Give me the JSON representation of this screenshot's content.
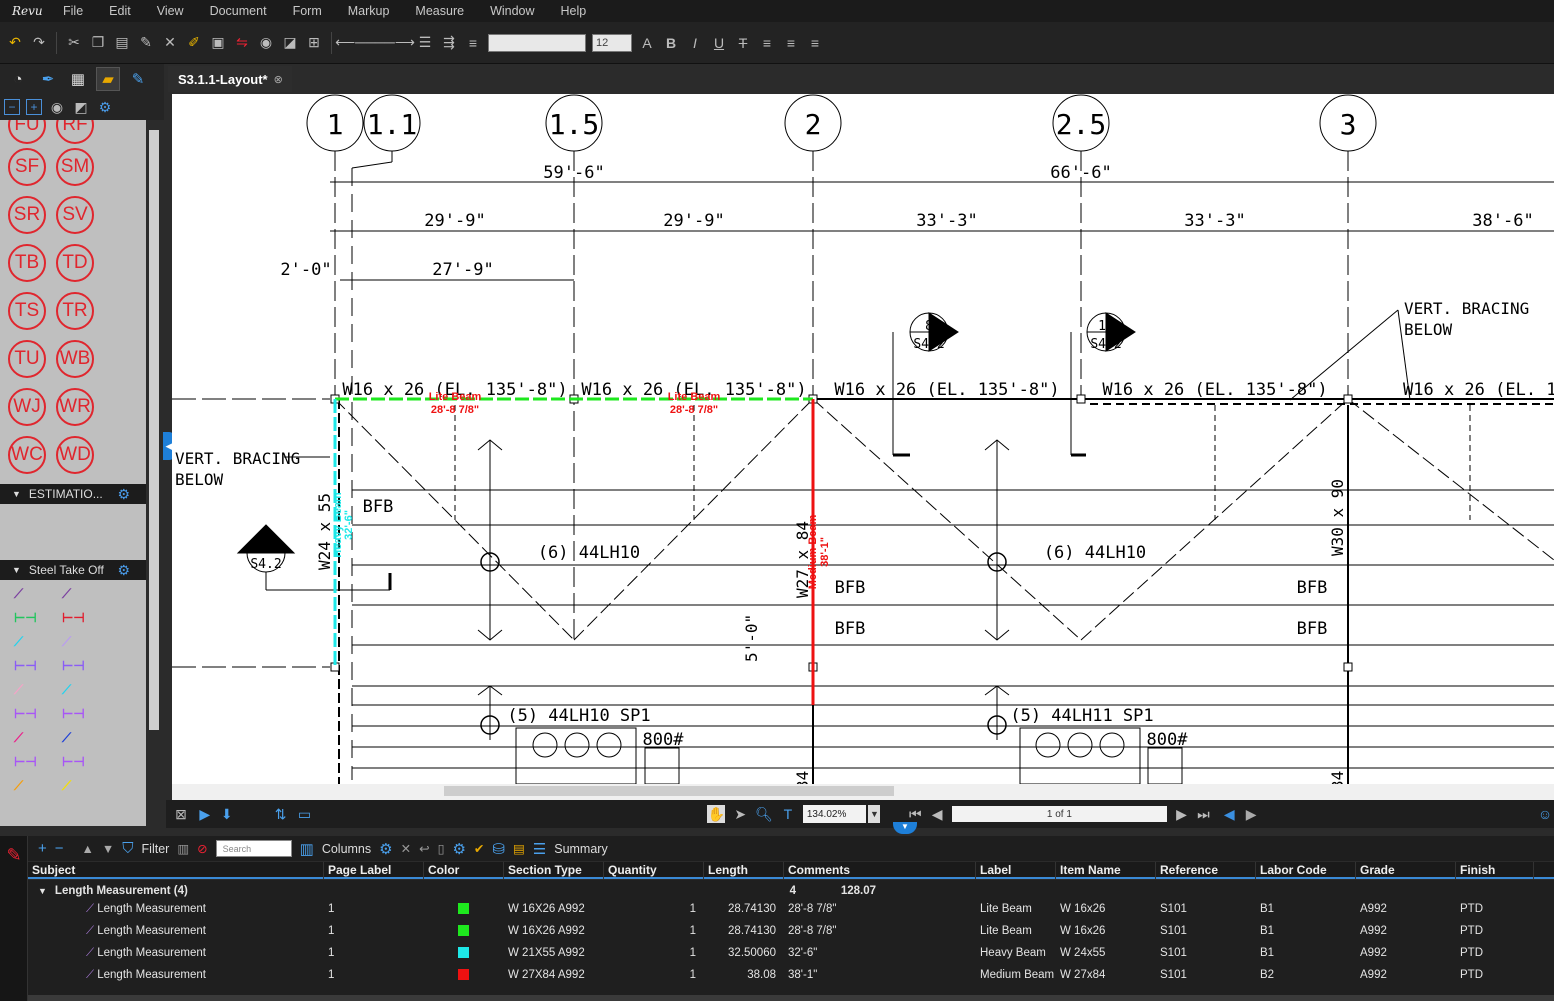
{
  "app": {
    "logo": "Revu",
    "menu": [
      "File",
      "Edit",
      "View",
      "Document",
      "Form",
      "Markup",
      "Measure",
      "Window",
      "Help"
    ],
    "font_size": "12"
  },
  "document": {
    "tab_title": "S3.1.1-Layout*"
  },
  "drawing": {
    "grid_bubbles": [
      "1",
      "1.1",
      "1.5",
      "2",
      "2.5",
      "3"
    ],
    "dims_top": [
      "59'-6\"",
      "66'-6\""
    ],
    "dims_second": [
      "29'-9\"",
      "29'-9\"",
      "33'-3\"",
      "33'-3\"",
      "38'-6\""
    ],
    "dim_small": "2'-0\"",
    "dim_27": "27'-9\"",
    "beams": [
      "W16 x 26 (EL. 135'-8\")",
      "W16 x 26 (EL. 135'-8\")",
      "W16 x 26 (EL. 135'-8\")",
      "W16 x 26 (EL. 135'-8\")",
      "W16 x 26 (EL. 135"
    ],
    "bracing_left": [
      "VERT. BRACING",
      "BELOW"
    ],
    "bracing_right": [
      "VERT. BRACING",
      "BELOW"
    ],
    "section_tags": [
      {
        "num": "8",
        "sheet": "S4.2"
      },
      {
        "num": "10",
        "sheet": "S4.2"
      },
      {
        "num": "7",
        "sheet": "S4.2"
      }
    ],
    "joists1": "(6) 44LH10",
    "joists2": "(6) 44LH10",
    "joists3": "(5) 44LH10 SP1",
    "joists4": "(5) 44LH11 SP1",
    "bfb": "BFB",
    "wt800": "800#",
    "dim_5": "5'-0\"",
    "col_left": "W24 x 55",
    "col_mid": "W27 x 84",
    "col_right": "W30 x 90",
    "col_far": "34",
    "markup_lite": "Lite Beam",
    "markup_lite_len": "28'-8 7/8\"",
    "markup_heavy": "Heavy Beam",
    "markup_heavy_len": "32'-6\"",
    "markup_medium": "Medium Beam",
    "markup_medium_len": "38'-1\""
  },
  "left_panel": {
    "stamps": [
      "FU",
      "RF",
      "SF",
      "SM",
      "SR",
      "SV",
      "TB",
      "TD",
      "TS",
      "TR",
      "TU",
      "WB",
      "WJ",
      "WR",
      "WC",
      "WD"
    ],
    "sections": [
      "ESTIMATIO...",
      "Steel Take Off"
    ],
    "tool_colors": [
      "#7b3fa0",
      "#7b3fa0",
      "#22c55e",
      "#e11d2e",
      "#22d3ee",
      "#b99cf0",
      "#8b5cf6",
      "#8b5cf6",
      "#f5a3c7",
      "#22d3ee",
      "#a855f7",
      "#a855f7",
      "#ec1f8a",
      "#1d3fd8",
      "#a855f7",
      "#a855f7",
      "#f59e0b",
      "#f5e000"
    ]
  },
  "status": {
    "zoom": "134.02%",
    "page": "1 of 1"
  },
  "markup_list": {
    "toolbar": {
      "filter": "Filter",
      "search_placeholder": "Search",
      "columns": "Columns",
      "summary": "Summary"
    },
    "columns": [
      "Subject",
      "Page Label",
      "Color",
      "Section Type",
      "Quantity",
      "Length",
      "Comments",
      "Label",
      "Item Name",
      "Reference",
      "Labor Code",
      "Grade",
      "Finish"
    ],
    "group": {
      "title": "Length Measurement (4)",
      "quantity": "4",
      "length": "128.07"
    },
    "rows": [
      {
        "subject": "Length Measurement",
        "page": "1",
        "color": "#1ee81e",
        "section": "W 16X26 A992",
        "qty": "1",
        "length": "28.74130",
        "comments": "28'-8 7/8\"",
        "label": "Lite Beam",
        "item": "W 16x26",
        "ref": "S101",
        "labor": "B1",
        "grade": "A992",
        "finish": "PTD"
      },
      {
        "subject": "Length Measurement",
        "page": "1",
        "color": "#1ee81e",
        "section": "W 16X26 A992",
        "qty": "1",
        "length": "28.74130",
        "comments": "28'-8 7/8\"",
        "label": "Lite Beam",
        "item": "W 16x26",
        "ref": "S101",
        "labor": "B1",
        "grade": "A992",
        "finish": "PTD"
      },
      {
        "subject": "Length Measurement",
        "page": "1",
        "color": "#1ee8e8",
        "section": "W 21X55 A992",
        "qty": "1",
        "length": "32.50060",
        "comments": "32'-6\"",
        "label": "Heavy Beam",
        "item": "W 24x55",
        "ref": "S101",
        "labor": "B1",
        "grade": "A992",
        "finish": "PTD"
      },
      {
        "subject": "Length Measurement",
        "page": "1",
        "color": "#ee1111",
        "section": "W 27X84 A992",
        "qty": "1",
        "length": "38.08",
        "comments": "38'-1\"",
        "label": "Medium Beam",
        "item": "W 27x84",
        "ref": "S101",
        "labor": "B2",
        "grade": "A992",
        "finish": "PTD"
      }
    ]
  }
}
